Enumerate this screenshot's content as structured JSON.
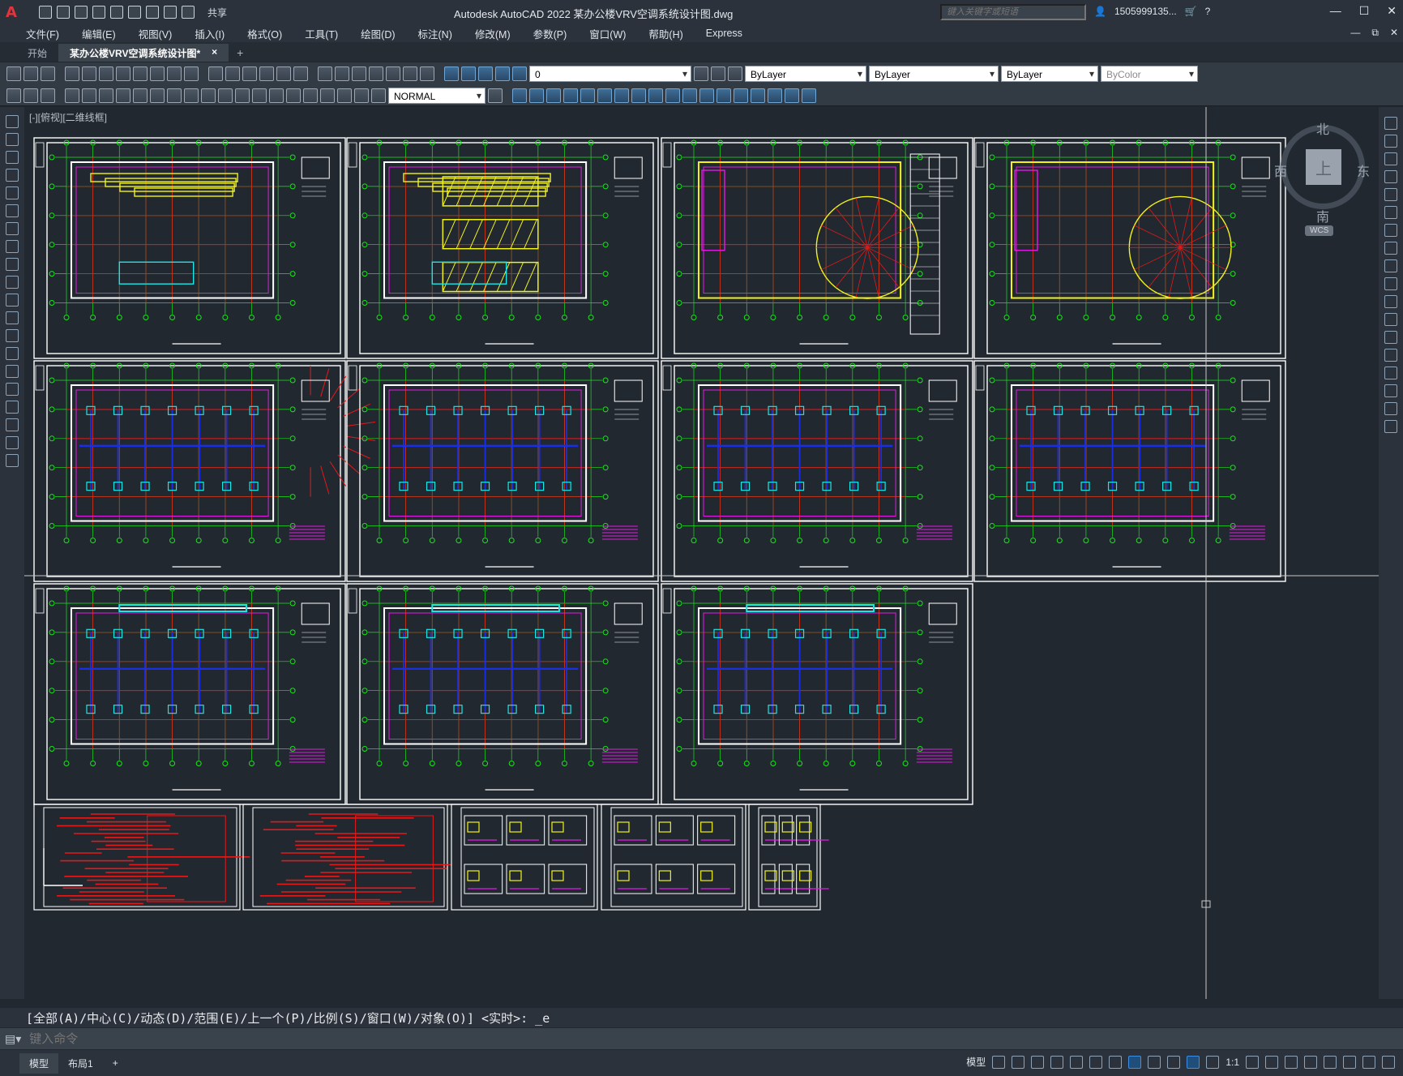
{
  "app": {
    "logo": "A",
    "title": "Autodesk AutoCAD 2022    某办公楼VRV空调系统设计图.dwg",
    "share_label": "共享",
    "search_placeholder": "键入关键字或短语",
    "user": "1505999135...",
    "window_controls": [
      "—",
      "☐",
      "✕"
    ]
  },
  "menu": {
    "items": [
      "文件(F)",
      "编辑(E)",
      "视图(V)",
      "插入(I)",
      "格式(O)",
      "工具(T)",
      "绘图(D)",
      "标注(N)",
      "修改(M)",
      "参数(P)",
      "窗口(W)",
      "帮助(H)",
      "Express"
    ],
    "right": [
      "—",
      "⧉",
      "✕"
    ]
  },
  "tabs": {
    "start": "开始",
    "active": "某办公楼VRV空调系统设计图*",
    "close": "×",
    "add": "+"
  },
  "toolbar": {
    "layer_value": "0",
    "color_value": "ByLayer",
    "linetype_value": "ByLayer",
    "lineweight_value": "ByLayer",
    "plotstyle_value": "ByColor",
    "textstyle_value": "NORMAL"
  },
  "viewport": {
    "label": "[-][俯视][二维线框]"
  },
  "viewcube": {
    "north": "北",
    "south": "南",
    "east": "东",
    "west": "西",
    "face": "上",
    "wcs": "WCS"
  },
  "command": {
    "history": "[全部(A)/中心(C)/动态(D)/范围(E)/上一个(P)/比例(S)/窗口(W)/对象(O)] <实时>: _e",
    "placeholder": "键入命令"
  },
  "status": {
    "model_tab": "模型",
    "layout_tab": "布局1",
    "add": "+",
    "model_label": "模型",
    "scale": "1:1"
  },
  "colors": {
    "background": "#212830",
    "grid_green": "#19e619",
    "axis_red": "#e61919",
    "wall_white": "#ffffff",
    "duct_yellow": "#f2f219",
    "pipe_blue": "#1a2ee6",
    "equip_magenta": "#e619e6",
    "duct_cyan": "#19e6e6"
  },
  "drawing": {
    "sheet_count": 16,
    "type": "HVAC VRV floor plans"
  }
}
